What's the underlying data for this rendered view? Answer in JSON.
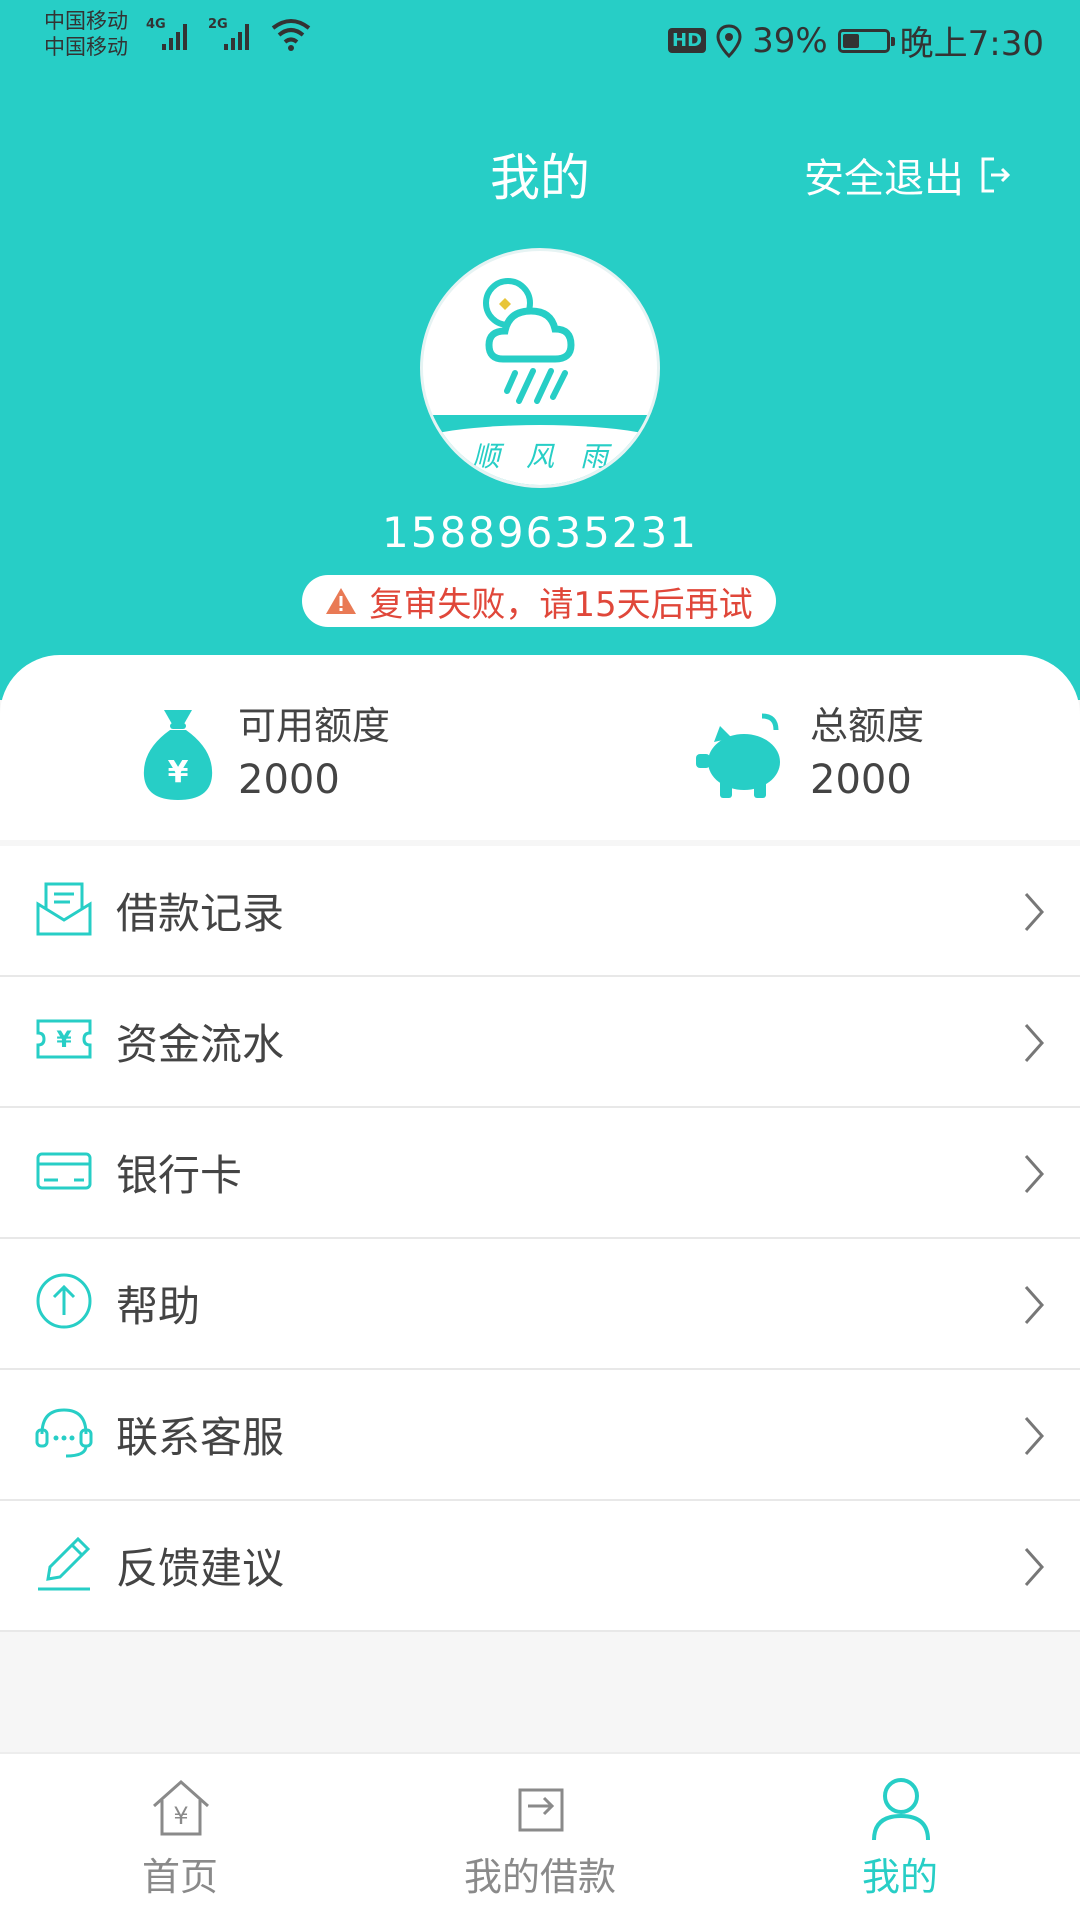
{
  "status_bar": {
    "carrier_1": "中国移动",
    "carrier_2": "中国移动",
    "net_1": "4G",
    "net_2": "2G",
    "hd": "HD",
    "battery_percent": "39%",
    "battery_level": 0.39,
    "time": "晚上7:30"
  },
  "header": {
    "title": "我的",
    "logout_label": "安全退出"
  },
  "profile": {
    "avatar_text": "顺风雨",
    "phone": "15889635231",
    "warning": "复审失败，请15天后再试"
  },
  "quota": {
    "available_label": "可用额度",
    "available_value": "2000",
    "total_label": "总额度",
    "total_value": "2000"
  },
  "menu": {
    "items": [
      {
        "label": "借款记录",
        "icon": "envelope-icon"
      },
      {
        "label": "资金流水",
        "icon": "ticket-yen-icon"
      },
      {
        "label": "银行卡",
        "icon": "bank-card-icon"
      },
      {
        "label": "帮助",
        "icon": "up-arrow-circle-icon"
      },
      {
        "label": "联系客服",
        "icon": "headset-icon"
      },
      {
        "label": "反馈建议",
        "icon": "pencil-icon"
      }
    ]
  },
  "tabbar": {
    "tabs": [
      {
        "label": "首页",
        "icon": "home-yen-icon"
      },
      {
        "label": "我的借款",
        "icon": "loan-icon"
      },
      {
        "label": "我的",
        "icon": "user-icon"
      }
    ],
    "active": 2
  },
  "colors": {
    "accent": "#27cec6",
    "warning": "#e0473a"
  }
}
